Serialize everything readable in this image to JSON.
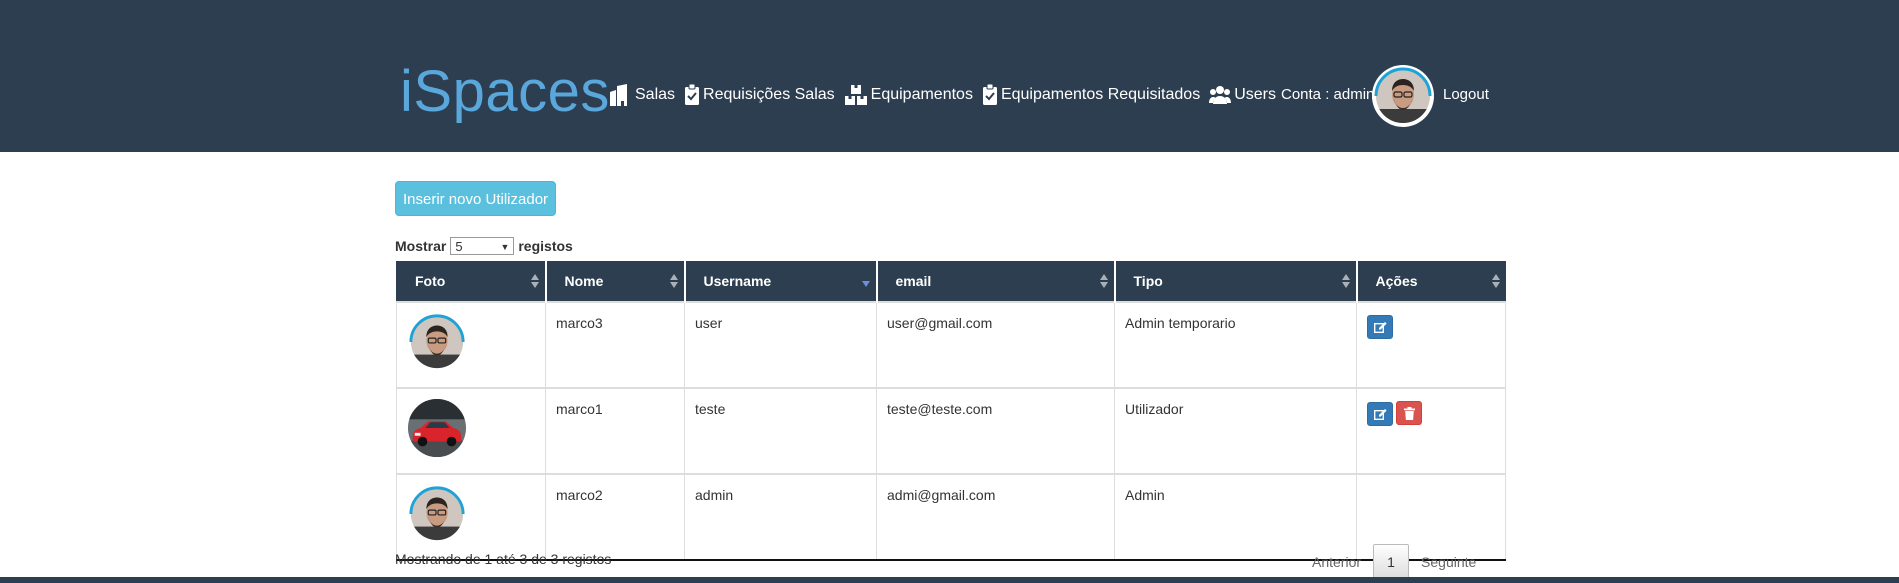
{
  "header": {
    "brand": "iSpaces",
    "nav": [
      {
        "label": "Salas",
        "icon": "building-icon"
      },
      {
        "label": "Requisições Salas",
        "icon": "clipboard-check-icon"
      },
      {
        "label": "Equipamentos",
        "icon": "boxes-icon"
      },
      {
        "label": "Equipamentos Requisitados",
        "icon": "clipboard-check-icon"
      },
      {
        "label": "Users",
        "icon": "users-icon"
      }
    ],
    "account_label": "Conta : admin",
    "logout_label": "Logout"
  },
  "actions": {
    "insert_label": "Inserir novo Utilizador"
  },
  "length_menu": {
    "prefix": "Mostrar",
    "value": "5",
    "suffix": "registos"
  },
  "table": {
    "columns": [
      "Foto",
      "Nome",
      "Username",
      "email",
      "Tipo",
      "Ações"
    ],
    "rows": [
      {
        "nome": "marco3",
        "username": "user",
        "email": "user@gmail.com",
        "tipo": "Admin temporario",
        "photo": "man-avatar",
        "actions": [
          "edit"
        ]
      },
      {
        "nome": "marco1",
        "username": "teste",
        "email": "teste@teste.com",
        "tipo": "Utilizador",
        "photo": "red-car",
        "actions": [
          "edit",
          "delete"
        ]
      },
      {
        "nome": "marco2",
        "username": "admin",
        "email": "admi@gmail.com",
        "tipo": "Admin",
        "photo": "man-avatar",
        "actions": []
      }
    ]
  },
  "footer": {
    "info": "Mostrando de 1 até 3 de 3 registos",
    "prev_label": "Anterior",
    "current_page": "1",
    "next_label": "Seguinte"
  },
  "colors": {
    "header_bg": "#2c3e50",
    "brand": "#5aa7dc",
    "info_button": "#5bc0de",
    "edit_button": "#337ab7",
    "delete_button": "#d9534f"
  }
}
